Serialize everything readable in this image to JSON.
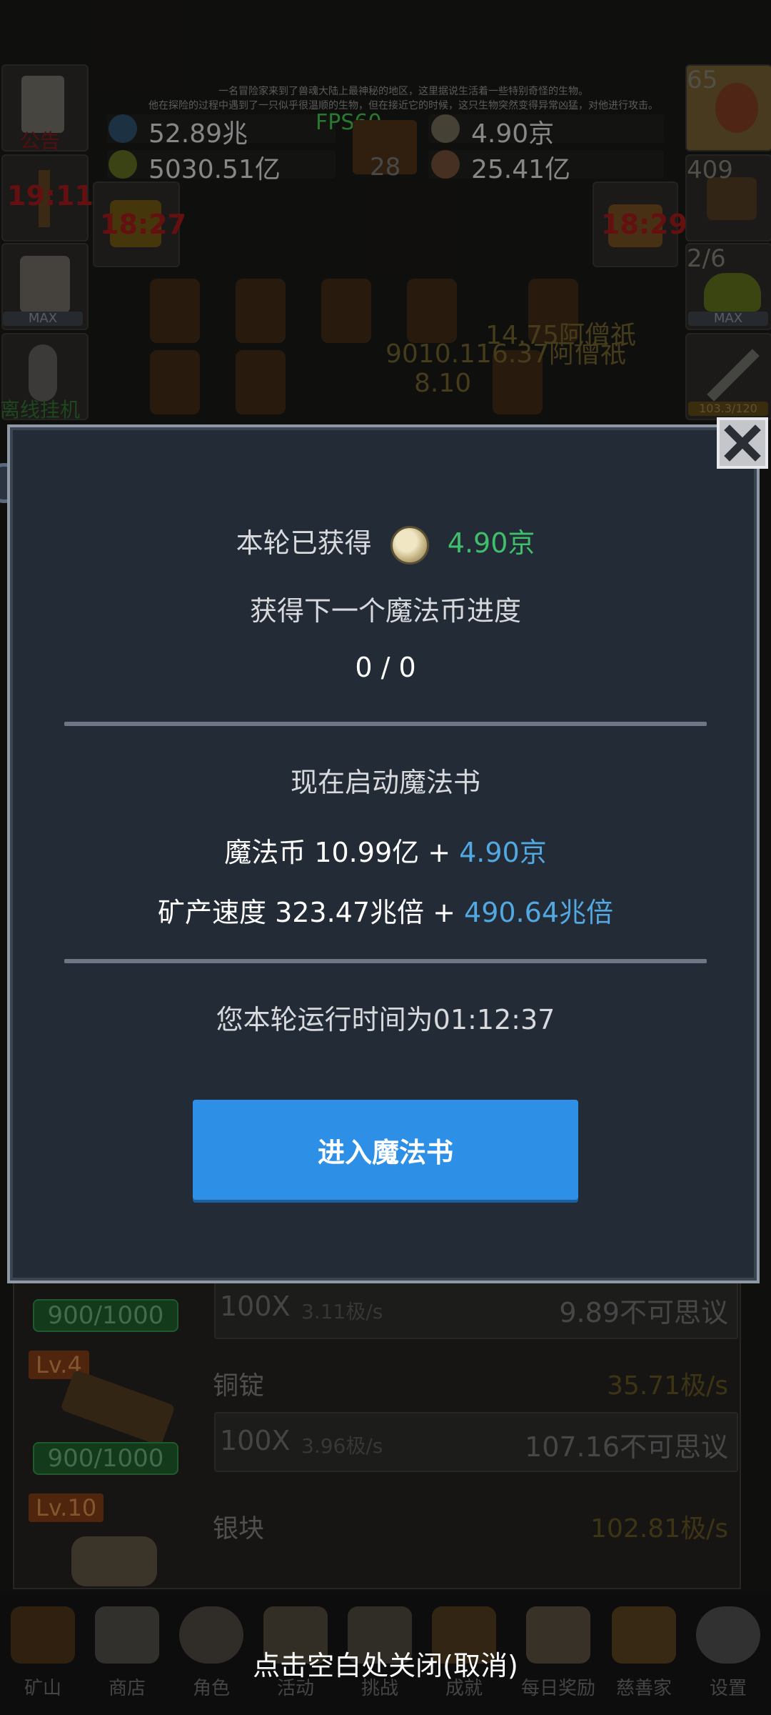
{
  "story": {
    "line1": "一名冒险家来到了兽魂大陆上最神秘的地区，这里据说生活着一些特别奇怪的生物。",
    "line2": "他在探险的过程中遇到了一只似乎很温顺的生物，但在接近它的时候，这只生物突然变得异常凶猛，对他进行攻击。"
  },
  "hud": {
    "fps": "FPS60",
    "res_left_top": "52.89兆",
    "res_left_bottom": "5030.51亿",
    "res_right_top": "4.90京",
    "res_right_bottom": "25.41亿",
    "book_count": "28",
    "timer_left": "18:27",
    "timer_right": "18:29",
    "left_side": {
      "announce": "公告",
      "torch_timer": "19:11",
      "max1": "MAX",
      "offline": "离线挂机"
    },
    "right_side": {
      "potion_count": "65",
      "chest_count": "409",
      "slime_count": "2/6",
      "max2": "MAX",
      "sword_progress": "103.3/120"
    },
    "float_texts": [
      "14.75阿僧祇",
      "9010.116.37阿僧祇",
      "8.10"
    ]
  },
  "modal": {
    "earned_label": "本轮已获得",
    "earned_value": "4.90京",
    "progress_label": "获得下一个魔法币进度",
    "progress_value": "0 / 0",
    "start_label": "现在启动魔法书",
    "coins_label": "魔法币 10.99亿 + ",
    "coins_bonus": "4.90京",
    "speed_label": "矿产速度 323.47兆倍 + ",
    "speed_bonus": "490.64兆倍",
    "runtime": "您本轮运行时间为01:12:37",
    "enter_button": "进入魔法书",
    "colors": {
      "green": "#3fbe6b",
      "blue": "#52a8e0",
      "button": "#2d8fe6"
    }
  },
  "list": {
    "items": [
      {
        "count": "900/1000",
        "mult": "100X",
        "mult_rate": "3.11极/s",
        "cost": "9.89不可思议"
      },
      {
        "level": "Lv.4",
        "name": "铜锭",
        "rate": "35.71极/s",
        "count": "900/1000",
        "mult": "100X",
        "mult_rate": "3.96极/s",
        "cost": "107.16不可思议"
      },
      {
        "level": "Lv.10",
        "name": "银块",
        "rate": "102.81极/s"
      }
    ]
  },
  "nav": {
    "items": [
      {
        "label": "矿山",
        "icon": "lantern-icon"
      },
      {
        "label": "商店",
        "icon": "ore-bag-icon"
      },
      {
        "label": "角色",
        "icon": "skull-icon"
      },
      {
        "label": "活动",
        "icon": "scroll-icon"
      },
      {
        "label": "挑战",
        "icon": "map-icon"
      },
      {
        "label": "成就",
        "icon": "key-icon"
      },
      {
        "label": "每日奖励",
        "icon": "letter-icon"
      },
      {
        "label": "慈善家",
        "icon": "bread-icon"
      },
      {
        "label": "设置",
        "icon": "gear-icon"
      }
    ],
    "close_hint": "点击空白处关闭(取消)"
  }
}
